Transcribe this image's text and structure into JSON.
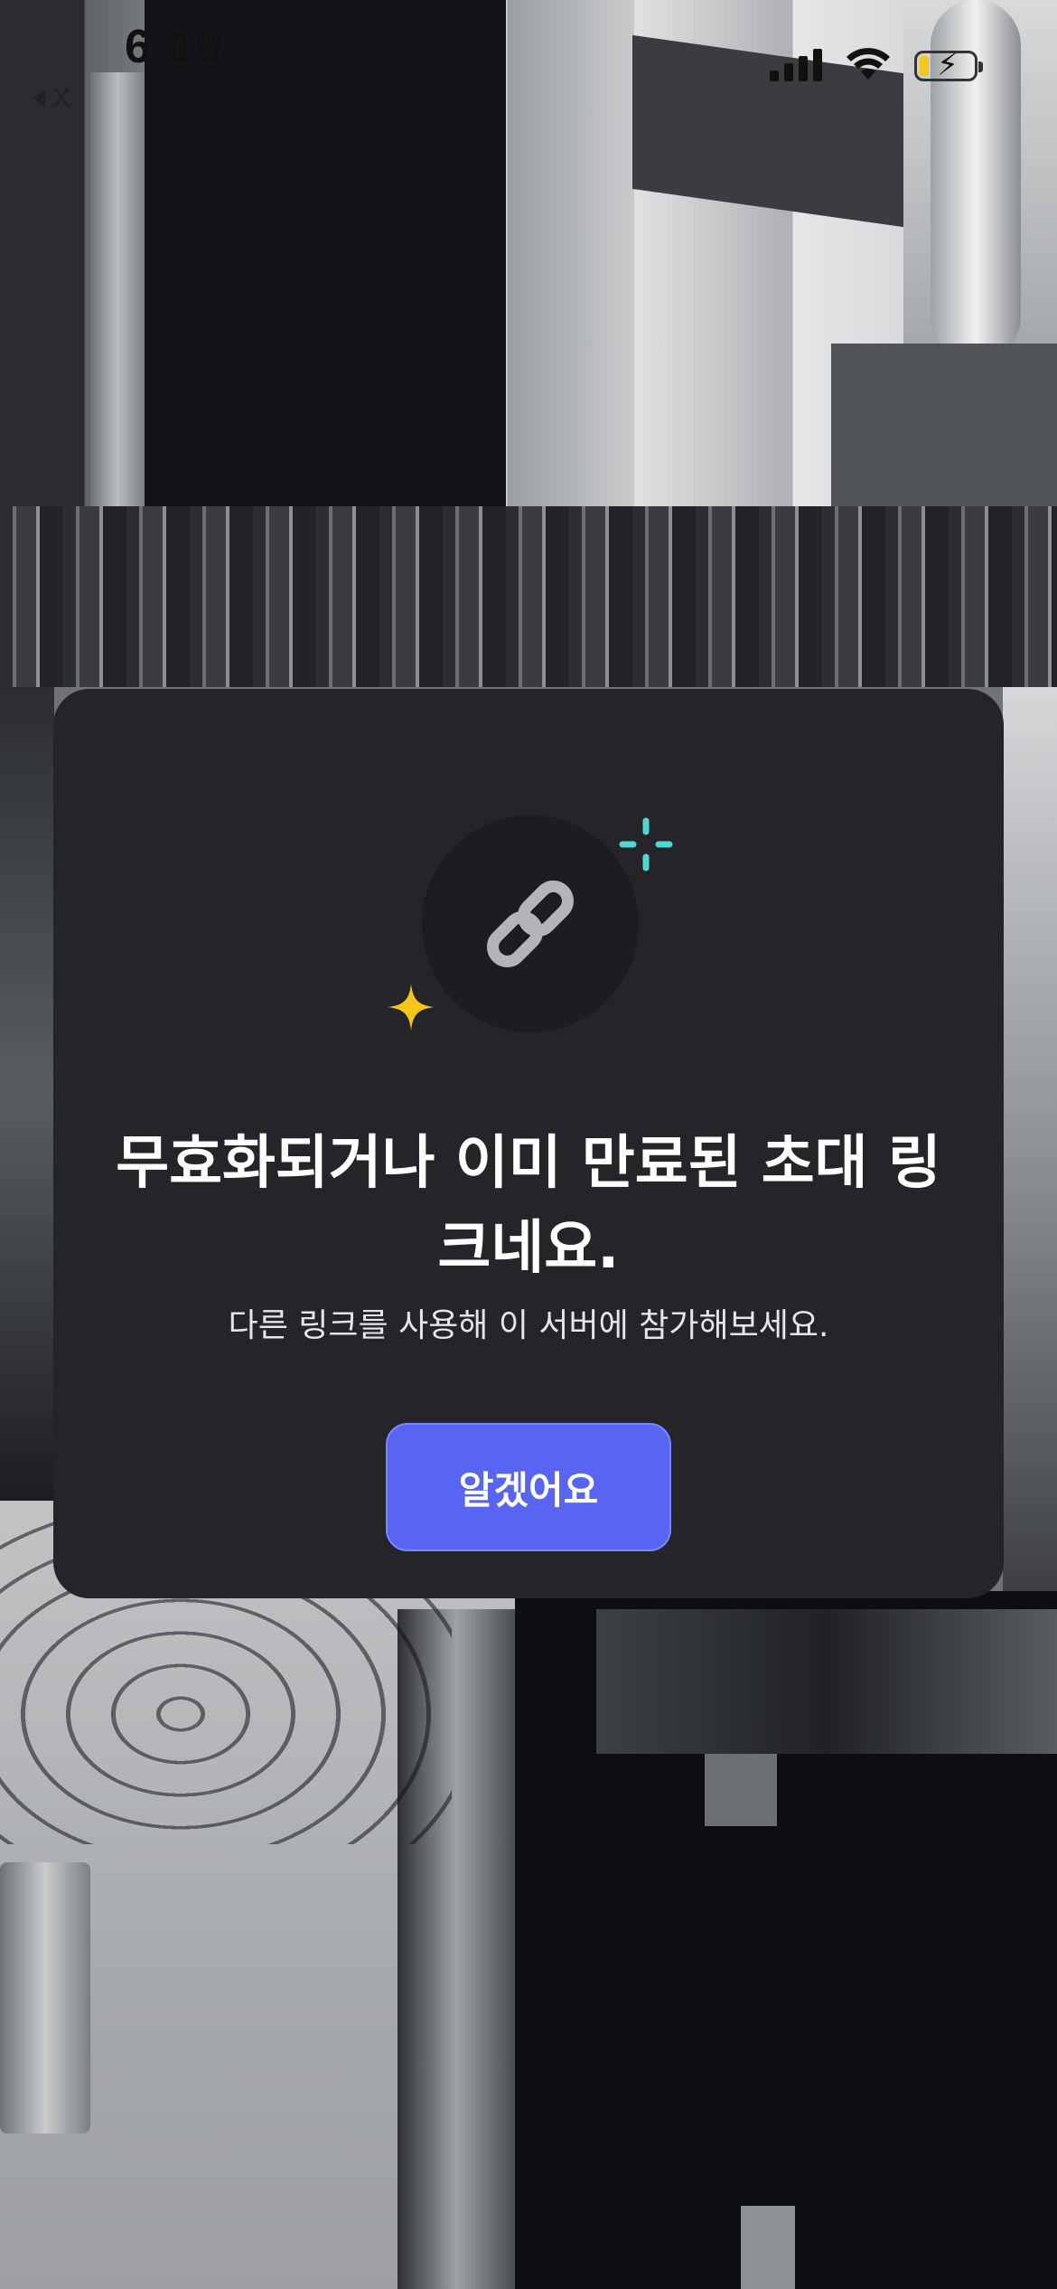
{
  "status_bar": {
    "time": "6:19",
    "back_app_label": "X",
    "icons": [
      "cellular-signal-icon",
      "wifi-icon",
      "battery-charging-icon"
    ]
  },
  "modal": {
    "hero_icon": "link-icon",
    "decorations": [
      "sparkle-blue-icon",
      "sparkle-yellow-icon"
    ],
    "title": "무효화되거나 이미 만료된 초대 링크네요.",
    "subtitle": "다른 링크를 사용해 이 서버에 참가해보세요.",
    "button_label": "알겠어요"
  },
  "colors": {
    "modal_background": "#242429",
    "button": "#5865F2",
    "sparkle_blue": "#4FD6D6",
    "sparkle_yellow": "#F5C518",
    "icon_gray": "#B3B3B8"
  }
}
